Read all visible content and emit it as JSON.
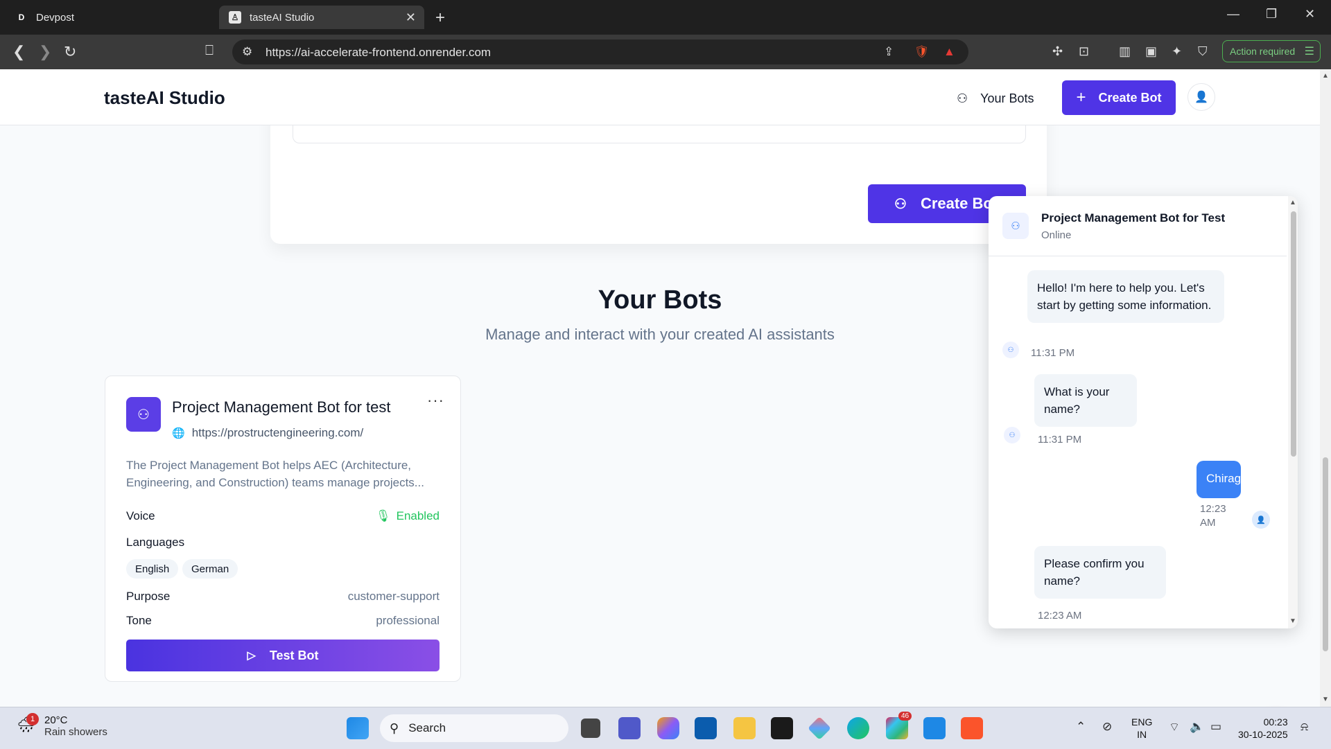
{
  "browser": {
    "tabs": [
      {
        "label": "Devpost",
        "icon": "D"
      },
      {
        "label": "tasteAI Studio"
      }
    ],
    "url": "https://ai-accelerate-frontend.onrender.com",
    "action_required": "Action required"
  },
  "header": {
    "brand": "tasteAI Studio",
    "your_bots": "Your Bots",
    "create_bot": "Create Bot"
  },
  "form": {
    "create_bot": "Create Bot"
  },
  "section": {
    "title": "Your Bots",
    "subtitle": "Manage and interact with your created AI assistants"
  },
  "bot_card": {
    "name": "Project Management Bot for test",
    "url": "https://prostructengineering.com/",
    "description": "The Project Management Bot helps AEC (Architecture, Engineering, and Construction) teams manage projects...",
    "voice_label": "Voice",
    "voice_value": "Enabled",
    "languages_label": "Languages",
    "languages": [
      "English",
      "German"
    ],
    "purpose_label": "Purpose",
    "purpose_value": "customer-support",
    "tone_label": "Tone",
    "tone_value": "professional",
    "test_button": "Test Bot"
  },
  "chat": {
    "title": "Project Management Bot for Test",
    "status": "Online",
    "messages": [
      {
        "from": "bot",
        "text": "Hello! I'm here to help you. Let's start by getting some information.",
        "time": "11:31 PM"
      },
      {
        "from": "bot",
        "text": "What is your name?",
        "time": "11:31 PM"
      },
      {
        "from": "user",
        "text": "Chirag",
        "time_line1": "12:23",
        "time_line2": "AM"
      },
      {
        "from": "bot",
        "text": "Please confirm you name?",
        "time": "12:23 AM"
      }
    ]
  },
  "taskbar": {
    "weather_badge": "1",
    "temperature": "20°C",
    "weather": "Rain showers",
    "search": "Search",
    "notification_count": "46",
    "lang_line1": "ENG",
    "lang_line2": "IN",
    "time": "00:23",
    "date": "30-10-2025"
  },
  "colors": {
    "primary": "#4f34e6",
    "chat_user_bubble": "#3b82f6",
    "enabled_green": "#22c55e"
  }
}
